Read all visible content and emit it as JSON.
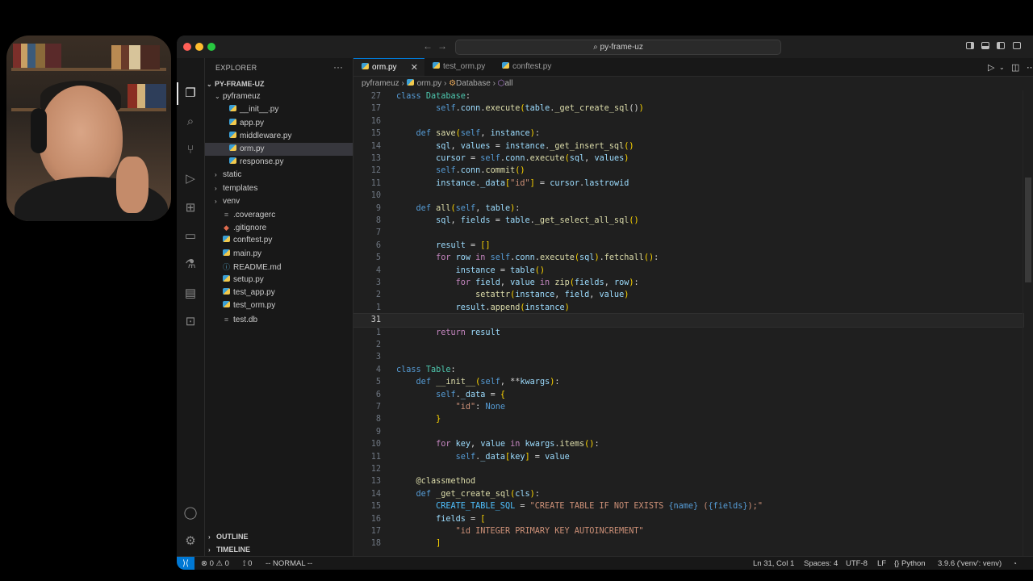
{
  "window": {
    "title": "py-frame-uz"
  },
  "sidebar": {
    "header": "EXPLORER",
    "more": "···",
    "root": "PY-FRAME-UZ",
    "items": [
      {
        "label": "pyframeuz",
        "type": "folder-open",
        "depth": 1
      },
      {
        "label": "__init__.py",
        "type": "py",
        "depth": 2
      },
      {
        "label": "app.py",
        "type": "py",
        "depth": 2
      },
      {
        "label": "middleware.py",
        "type": "py",
        "depth": 2
      },
      {
        "label": "orm.py",
        "type": "py",
        "depth": 2,
        "selected": true
      },
      {
        "label": "response.py",
        "type": "py",
        "depth": 2
      },
      {
        "label": "static",
        "type": "folder",
        "depth": 1
      },
      {
        "label": "templates",
        "type": "folder",
        "depth": 1
      },
      {
        "label": "venv",
        "type": "folder",
        "depth": 1
      },
      {
        "label": ".coveragerc",
        "type": "config",
        "depth": 1
      },
      {
        "label": ".gitignore",
        "type": "git",
        "depth": 1
      },
      {
        "label": "conftest.py",
        "type": "py",
        "depth": 1
      },
      {
        "label": "main.py",
        "type": "py",
        "depth": 1
      },
      {
        "label": "README.md",
        "type": "md",
        "depth": 1
      },
      {
        "label": "setup.py",
        "type": "py",
        "depth": 1
      },
      {
        "label": "test_app.py",
        "type": "py",
        "depth": 1
      },
      {
        "label": "test_orm.py",
        "type": "py",
        "depth": 1
      },
      {
        "label": "test.db",
        "type": "db",
        "depth": 1
      }
    ],
    "outline": "OUTLINE",
    "timeline": "TIMELINE"
  },
  "tabs": [
    {
      "label": "orm.py",
      "active": true,
      "close": "✕"
    },
    {
      "label": "test_orm.py",
      "active": false
    },
    {
      "label": "conftest.py",
      "active": false
    }
  ],
  "breadcrumb": {
    "folder": "pyframeuz",
    "file": "orm.py",
    "class": "Database",
    "method": "all",
    "sep": "›"
  },
  "editor": {
    "lines": [
      {
        "n": "27",
        "h": "<span class='kw'>class</span> <span class='cls'>Database</span>:"
      },
      {
        "n": "17",
        "h": "        <span class='self'>self</span>.<span class='var'>conn</span>.<span class='fn'>execute</span><span class='brk'>(</span><span class='var'>table</span>.<span class='fn'>_get_create_sql</span>()<span class='brk'>)</span>"
      },
      {
        "n": "16",
        "h": ""
      },
      {
        "n": "15",
        "h": "    <span class='kw'>def</span> <span class='fn'>save</span><span class='brk'>(</span><span class='self'>self</span>, <span class='var'>instance</span><span class='brk'>)</span>:"
      },
      {
        "n": "14",
        "h": "        <span class='var'>sql</span>, <span class='var'>values</span> = <span class='var'>instance</span>.<span class='fn'>_get_insert_sql</span><span class='brk'>()</span>"
      },
      {
        "n": "13",
        "h": "        <span class='var'>cursor</span> = <span class='self'>self</span>.<span class='var'>conn</span>.<span class='fn'>execute</span><span class='brk'>(</span><span class='var'>sql</span>, <span class='var'>values</span><span class='brk'>)</span>"
      },
      {
        "n": "12",
        "h": "        <span class='self'>self</span>.<span class='var'>conn</span>.<span class='fn'>commit</span><span class='brk'>()</span>"
      },
      {
        "n": "11",
        "h": "        <span class='var'>instance</span>.<span class='var'>_data</span><span class='brk'>[</span><span class='str'>\"id\"</span><span class='brk'>]</span> = <span class='var'>cursor</span>.<span class='var'>lastrowid</span>"
      },
      {
        "n": "10",
        "h": ""
      },
      {
        "n": "9",
        "h": "    <span class='kw'>def</span> <span class='fn'>all</span><span class='brk'>(</span><span class='self'>self</span>, <span class='var'>table</span><span class='brk'>)</span>:"
      },
      {
        "n": "8",
        "h": "        <span class='var'>sql</span>, <span class='var'>fields</span> = <span class='var'>table</span>.<span class='fn'>_get_select_all_sql</span><span class='brk'>()</span>"
      },
      {
        "n": "7",
        "h": ""
      },
      {
        "n": "6",
        "h": "        <span class='var'>result</span> = <span class='brk'>[]</span>"
      },
      {
        "n": "5",
        "h": "        <span class='ctl'>for</span> <span class='var'>row</span> <span class='ctl'>in</span> <span class='self'>self</span>.<span class='var'>conn</span>.<span class='fn'>execute</span><span class='brk'>(</span><span class='var'>sql</span><span class='brk'>)</span>.<span class='fn'>fetchall</span><span class='brk'>()</span>:"
      },
      {
        "n": "4",
        "h": "            <span class='var'>instance</span> = <span class='var'>table</span><span class='brk'>()</span>"
      },
      {
        "n": "3",
        "h": "            <span class='ctl'>for</span> <span class='var'>field</span>, <span class='var'>value</span> <span class='ctl'>in</span> <span class='fn'>zip</span><span class='brk'>(</span><span class='var'>fields</span>, <span class='var'>row</span><span class='brk'>)</span>:"
      },
      {
        "n": "2",
        "h": "                <span class='fn'>setattr</span><span class='brk'>(</span><span class='var'>instance</span>, <span class='var'>field</span>, <span class='var'>value</span><span class='brk'>)</span>"
      },
      {
        "n": "1",
        "h": "            <span class='var'>result</span>.<span class='fn'>append</span><span class='brk'>(</span><span class='var'>instance</span><span class='brk'>)</span>"
      },
      {
        "n": "31",
        "h": "",
        "current": true
      },
      {
        "n": "1",
        "h": "        <span class='ctl'>return</span> <span class='var'>result</span>"
      },
      {
        "n": "2",
        "h": ""
      },
      {
        "n": "3",
        "h": ""
      },
      {
        "n": "4",
        "h": "<span class='kw'>class</span> <span class='cls'>Table</span>:"
      },
      {
        "n": "5",
        "h": "    <span class='kw'>def</span> <span class='fn'>__init__</span><span class='brk'>(</span><span class='self'>self</span>, **<span class='var'>kwargs</span><span class='brk'>)</span>:"
      },
      {
        "n": "6",
        "h": "        <span class='self'>self</span>.<span class='var'>_data</span> = <span class='brk'>{</span>"
      },
      {
        "n": "7",
        "h": "            <span class='str'>\"id\"</span>: <span class='kw'>None</span>"
      },
      {
        "n": "8",
        "h": "        <span class='brk'>}</span>"
      },
      {
        "n": "9",
        "h": ""
      },
      {
        "n": "10",
        "h": "        <span class='ctl'>for</span> <span class='var'>key</span>, <span class='var'>value</span> <span class='ctl'>in</span> <span class='var'>kwargs</span>.<span class='fn'>items</span><span class='brk'>()</span>:"
      },
      {
        "n": "11",
        "h": "            <span class='self'>self</span>.<span class='var'>_data</span><span class='brk'>[</span><span class='var'>key</span><span class='brk'>]</span> = <span class='var'>value</span>"
      },
      {
        "n": "12",
        "h": ""
      },
      {
        "n": "13",
        "h": "    <span class='dec'>@classmethod</span>"
      },
      {
        "n": "14",
        "h": "    <span class='kw'>def</span> <span class='fn'>_get_create_sql</span><span class='brk'>(</span><span class='var'>cls</span><span class='brk'>)</span>:"
      },
      {
        "n": "15",
        "h": "        <span class='const'>CREATE_TABLE_SQL</span> = <span class='str'>\"CREATE TABLE IF NOT EXISTS </span><span class='kw'>{name}</span><span class='str'> (</span><span class='kw'>{fields}</span><span class='str'>);\"</span>"
      },
      {
        "n": "16",
        "h": "        <span class='var'>fields</span> = <span class='brk'>[</span>"
      },
      {
        "n": "17",
        "h": "            <span class='str'>\"id INTEGER PRIMARY KEY AUTOINCREMENT\"</span>"
      },
      {
        "n": "18",
        "h": "        <span class='brk'>]</span>"
      }
    ]
  },
  "statusbar": {
    "remote": "⟩⟨",
    "errors": "⊗ 0 ⚠ 0",
    "ports": "⟟ 0",
    "mode": "-- NORMAL --",
    "position": "Ln 31, Col 1",
    "spaces": "Spaces: 4",
    "encoding": "UTF-8",
    "eol": "LF",
    "language": "{} Python",
    "interpreter": "3.9.6 ('venv': venv)",
    "bell": "🔔"
  },
  "colors": {
    "accent": "#0078d4",
    "background": "#1f1f1f",
    "sidebar": "#181818"
  }
}
